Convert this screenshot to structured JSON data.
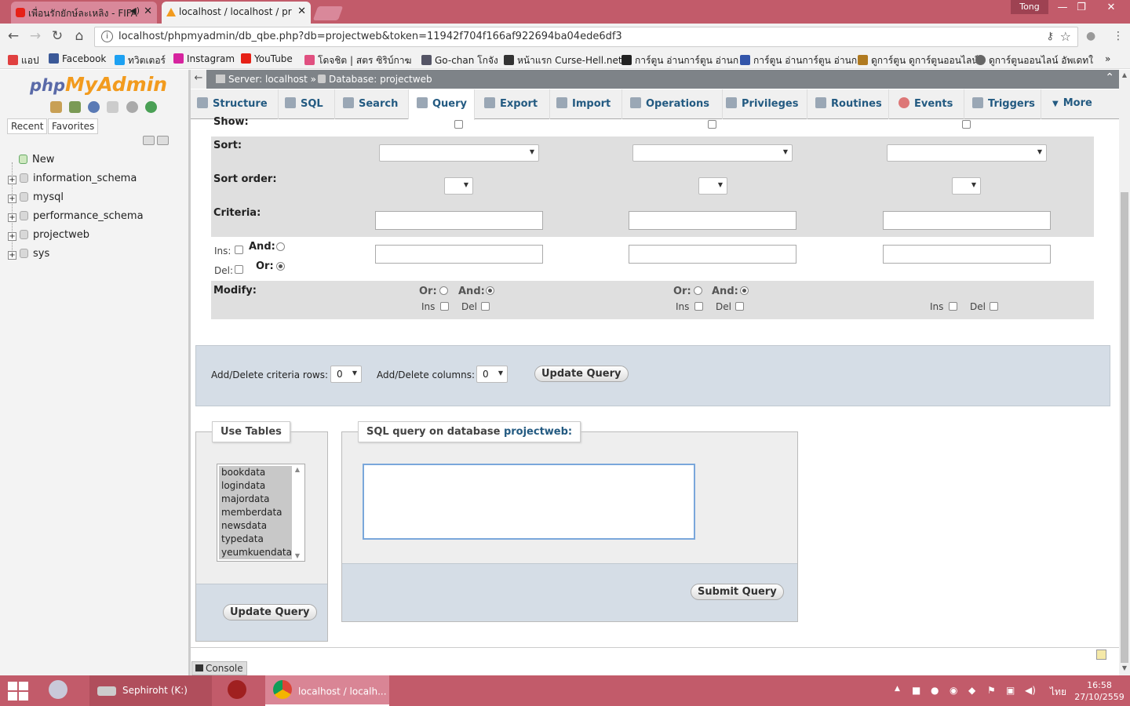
{
  "browser": {
    "tabs": [
      {
        "title": "เพื่อนรักยักษ์ละเหลิง - FIFA",
        "favicon": "youtube-icon"
      },
      {
        "title": "localhost / localhost / pr",
        "favicon": "phpmyadmin-icon"
      }
    ],
    "user": "Tong",
    "url": "localhost/phpmyadmin/db_qbe.php?db=projectweb&token=11942f704f166af922694ba04ede6df3",
    "bookmarks": [
      {
        "label": "แอป",
        "color": "#e04040"
      },
      {
        "label": "Facebook",
        "color": "#3b5998"
      },
      {
        "label": "ทวิตเตอร์",
        "color": "#1da1f2"
      },
      {
        "label": "Instagram",
        "color": "#d6249f"
      },
      {
        "label": "YouTube",
        "color": "#e62117"
      },
      {
        "label": "โดจชิต | สตร ซิริบ์กาฆ",
        "color": "#e05080"
      },
      {
        "label": "Go-chan โกจัง",
        "color": "#556"
      },
      {
        "label": "หน้าแรก Curse-Hell.net",
        "color": "#333"
      },
      {
        "label": "การ์ตูน อ่านการ์ตูน อ่านก",
        "color": "#222"
      },
      {
        "label": "การ์ตูน อ่านการ์ตูน อ่านก",
        "color": "#3355aa"
      },
      {
        "label": "ดูการ์ตูน ดูการ์ตูนออนไลน์",
        "color": "#b07a20"
      },
      {
        "label": "ดูการ์ตูนออนไลน์ อัพเดทใ",
        "color": "#666"
      }
    ]
  },
  "sidebar": {
    "logo_php": "php",
    "logo_my": "My",
    "logo_admin": "Admin",
    "recent_label": "Recent",
    "favorites_label": "Favorites",
    "tree": [
      "New",
      "information_schema",
      "mysql",
      "performance_schema",
      "projectweb",
      "sys"
    ]
  },
  "breadcrumb": {
    "server": "Server: localhost »",
    "database": "Database: projectweb"
  },
  "menu": {
    "tabs": [
      "Structure",
      "SQL",
      "Search",
      "Query",
      "Export",
      "Import",
      "Operations",
      "Privileges",
      "Routines",
      "Events",
      "Triggers",
      "More"
    ],
    "active": "Query"
  },
  "qbe": {
    "show_label": "Show:",
    "sort_label": "Sort:",
    "sort_order_label": "Sort order:",
    "criteria_label": "Criteria:",
    "ins_label": "Ins:",
    "del_label": "Del:",
    "and_label": "And:",
    "or_label": "Or:",
    "modify_label": "Modify:",
    "modify_or": "Or:",
    "modify_and": "And:",
    "modify_ins": "Ins",
    "modify_del": "Del"
  },
  "update_panel": {
    "rows_label": "Add/Delete criteria rows:",
    "rows_value": "0",
    "cols_label": "Add/Delete columns:",
    "cols_value": "0",
    "update_button": "Update Query"
  },
  "use_tables": {
    "legend": "Use Tables",
    "tables": [
      "bookdata",
      "logindata",
      "majordata",
      "memberdata",
      "newsdata",
      "typedata",
      "yeumkuendata"
    ],
    "update_button": "Update Query"
  },
  "sql_query": {
    "legend_prefix": "SQL query on database",
    "legend_db": "projectweb:",
    "value": "",
    "submit_button": "Submit Query"
  },
  "console_label": "Console",
  "taskbar": {
    "items": [
      "Sephiroht (K:)",
      "localhost / localh..."
    ],
    "language": "ไทย",
    "time": "16:58",
    "date": "27/10/2559"
  }
}
